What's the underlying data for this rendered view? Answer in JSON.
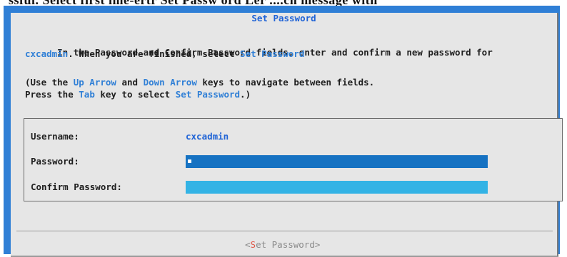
{
  "top_caption": "ssful. Select first ime-ertr  Set Passw ord Ler ....ch message with",
  "dialog": {
    "title": "Set Password"
  },
  "instructions": {
    "line1_a": "In the Password and Confirm Password fields, enter and confirm a new password for",
    "line2_user": "cxcadmin",
    "line2_b": ". When you are finished, select ",
    "line2_link": "Set Password",
    "line3_a": "(Use the ",
    "line3_up": "Up Arrow",
    "line3_b": " and ",
    "line3_down": "Down Arrow",
    "line3_c": " keys to navigate between fields.",
    "line4_a": "Press the ",
    "line4_tab": "Tab",
    "line4_b": " key to select ",
    "line4_link": "Set Password",
    "line4_c": ".)"
  },
  "form": {
    "username_label": "Username:",
    "username_value": "cxcadmin",
    "password_label": "Password:",
    "password_value": "",
    "confirm_label": "Confirm Password:",
    "confirm_value": ""
  },
  "button": {
    "open_bracket": "<",
    "hotkey": "S",
    "rest": "et Password",
    "close_bracket": ">"
  },
  "colors": {
    "frame": "#2f7fd6",
    "background": "#e6e6e6",
    "highlight_text": "#2f7fd6",
    "password_field_active": "#1672c2",
    "confirm_field": "#33b3e5",
    "hotkey": "#e05a4a"
  }
}
